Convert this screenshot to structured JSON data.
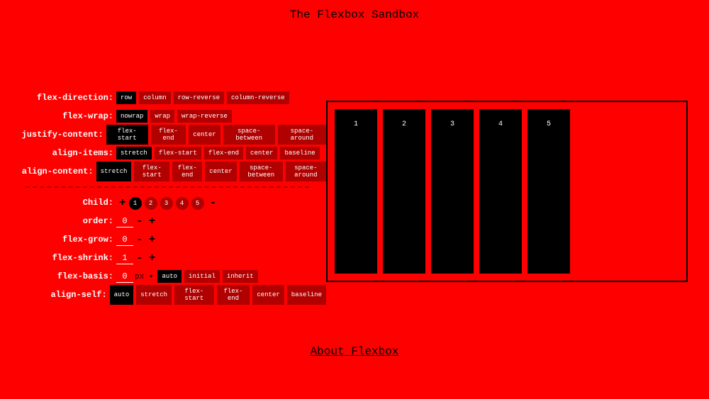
{
  "title": "The Flexbox Sandbox",
  "footer": "About Flexbox",
  "labels": {
    "flexDirection": "flex-direction:",
    "flexWrap": "flex-wrap:",
    "justifyContent": "justify-content:",
    "alignItems": "align-items:",
    "alignContent": "align-content:",
    "child": "Child:",
    "order": "order:",
    "flexGrow": "flex-grow:",
    "flexShrink": "flex-shrink:",
    "flexBasis": "flex-basis:",
    "alignSelf": "align-self:"
  },
  "container": {
    "flexDirection": {
      "active": "row",
      "options": [
        "row",
        "column",
        "row-reverse",
        "column-reverse"
      ]
    },
    "flexWrap": {
      "active": "nowrap",
      "options": [
        "nowrap",
        "wrap",
        "wrap-reverse"
      ]
    },
    "justifyContent": {
      "active": "flex-start",
      "options": [
        "flex-start",
        "flex-end",
        "center",
        "space-between",
        "space-around"
      ]
    },
    "alignItems": {
      "active": "stretch",
      "options": [
        "stretch",
        "flex-start",
        "flex-end",
        "center",
        "baseline"
      ]
    },
    "alignContent": {
      "active": "stretch",
      "options": [
        "stretch",
        "flex-start",
        "flex-end",
        "center",
        "space-between",
        "space-around"
      ]
    }
  },
  "child": {
    "activeIndex": 0,
    "tabs": [
      "1",
      "2",
      "3",
      "4",
      "5"
    ],
    "order": "0",
    "flexGrow": "0",
    "flexShrink": "1",
    "flexBasis": "0",
    "basisUnit": "px",
    "basisOptions": {
      "active": "auto",
      "options": [
        "auto",
        "initial",
        "inherit"
      ]
    },
    "alignSelf": {
      "active": "auto",
      "options": [
        "auto",
        "stretch",
        "flex-start",
        "flex-end",
        "center",
        "baseline"
      ]
    }
  },
  "sandbox": {
    "items": [
      "1",
      "2",
      "3",
      "4",
      "5"
    ]
  },
  "glyphs": {
    "plus": "+",
    "minus": "-",
    "caret": "▾"
  }
}
